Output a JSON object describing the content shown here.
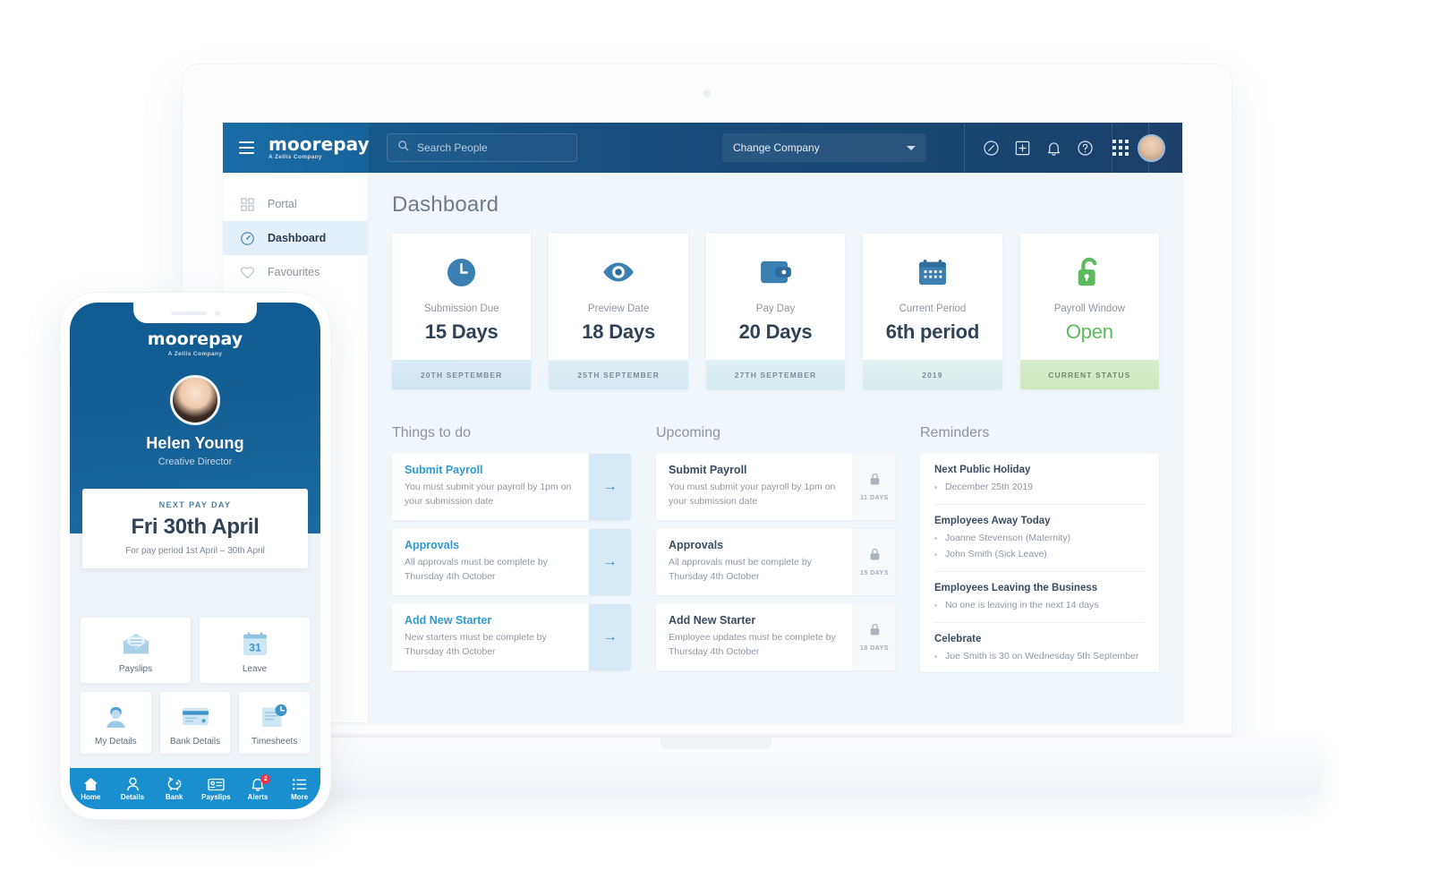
{
  "brand": {
    "wordmark": "moorepay",
    "tagline": "A Zellis Company"
  },
  "topnav": {
    "menu_icon": "hamburger-icon",
    "search": {
      "placeholder": "Search People",
      "value": "",
      "icon": "search-icon"
    },
    "company_selector": {
      "label": "Change Company",
      "icon": "chevron-down-icon"
    },
    "icons": [
      "compass-icon",
      "plus-square-icon",
      "bell-icon",
      "help-circle-icon",
      "app-grid-icon"
    ],
    "avatar": "user-avatar"
  },
  "sidebar": {
    "items": [
      {
        "label": "Portal",
        "icon": "grid-squares-icon",
        "active": false
      },
      {
        "label": "Dashboard",
        "icon": "speedometer-icon",
        "active": true
      },
      {
        "label": "Favourites",
        "icon": "heart-icon",
        "active": false
      }
    ]
  },
  "main": {
    "title": "Dashboard",
    "stats": [
      {
        "icon": "clock-icon",
        "label": "Submission Due",
        "value": "15 Days",
        "footer": "20TH SEPTEMBER",
        "accent": "#2f7db2"
      },
      {
        "icon": "eye-icon",
        "label": "Preview Date",
        "value": "18 Days",
        "footer": "25TH SEPTEMBER",
        "accent": "#2f7db2"
      },
      {
        "icon": "wallet-icon",
        "label": "Pay Day",
        "value": "20 Days",
        "footer": "27TH SEPTEMBER",
        "accent": "#2f7db2"
      },
      {
        "icon": "calendar-icon",
        "label": "Current Period",
        "value": "6th period",
        "footer": "2019",
        "accent": "#2f7db2"
      },
      {
        "icon": "unlock-icon",
        "label": "Payroll Window",
        "value": "Open",
        "footer": "CURRENT STATUS",
        "accent": "#5cbb5f"
      }
    ],
    "columns": {
      "things_to_do": {
        "title": "Things to do",
        "items": [
          {
            "title": "Submit Payroll",
            "desc": "You must submit your payroll by 1pm on your submission date",
            "action_icon": "arrow-right-icon"
          },
          {
            "title": "Approvals",
            "desc": "All approvals must be complete by Thursday 4th October",
            "action_icon": "arrow-right-icon"
          },
          {
            "title": "Add New Starter",
            "desc": "New starters must be complete by Thursday 4th October",
            "action_icon": "arrow-right-icon"
          }
        ]
      },
      "upcoming": {
        "title": "Upcoming",
        "items": [
          {
            "title": "Submit Payroll",
            "desc": "You must submit your payroll by 1pm on your submission date",
            "lock_icon": "lock-icon",
            "days": "11 DAYS"
          },
          {
            "title": "Approvals",
            "desc": "All approvals must be complete by Thursday 4th October",
            "lock_icon": "lock-icon",
            "days": "15 DAYS"
          },
          {
            "title": "Add New Starter",
            "desc": "Employee updates must be complete by Thursday 4th October",
            "lock_icon": "lock-icon",
            "days": "18 DAYS"
          }
        ]
      },
      "reminders": {
        "title": "Reminders",
        "blocks": [
          {
            "heading": "Next Public Holiday",
            "lines": [
              "December 25th 2019"
            ]
          },
          {
            "heading": "Employees Away Today",
            "lines": [
              "Joanne Stevenson (Maternity)",
              "John Smith (Sick Leave)"
            ]
          },
          {
            "heading": "Employees Leaving the Business",
            "lines": [
              "No one is leaving in the next 14 days"
            ]
          },
          {
            "heading": "Celebrate",
            "lines": [
              "Joe Smith is 30 on Wednesday 5th September"
            ]
          }
        ]
      }
    }
  },
  "phone": {
    "brand": {
      "wordmark": "moorepay",
      "tagline": "A Zellis Company"
    },
    "user": {
      "name": "Helen Young",
      "role": "Creative Director",
      "avatar": "user-avatar"
    },
    "payday": {
      "label": "NEXT PAY DAY",
      "date": "Fri 30th April",
      "period": "For pay period 1st April – 30th April"
    },
    "tiles_row1": [
      {
        "label": "Payslips",
        "icon": "envelope-payslip-icon"
      },
      {
        "label": "Leave",
        "icon": "calendar-31-icon"
      }
    ],
    "tiles_row2": [
      {
        "label": "My Details",
        "icon": "person-icon"
      },
      {
        "label": "Bank Details",
        "icon": "credit-card-icon"
      },
      {
        "label": "Timesheets",
        "icon": "timesheet-clock-icon"
      }
    ],
    "tabs": [
      {
        "label": "Home",
        "icon": "home-icon",
        "badge": ""
      },
      {
        "label": "Details",
        "icon": "person-icon",
        "badge": ""
      },
      {
        "label": "Bank",
        "icon": "piggy-bank-icon",
        "badge": ""
      },
      {
        "label": "Payslips",
        "icon": "payslip-card-icon",
        "badge": ""
      },
      {
        "label": "Alerts",
        "icon": "bell-icon",
        "badge": "2"
      },
      {
        "label": "More",
        "icon": "list-icon",
        "badge": ""
      }
    ]
  },
  "colors": {
    "nav_blue": "#17578a",
    "brand_blue": "#1a6ca6",
    "accent_cyan": "#2c9ad4",
    "status_green": "#5cbb5f",
    "app_bg": "#f1f6fb",
    "phone_tab_blue": "#1a8fd0",
    "badge_red": "#e8334a"
  }
}
